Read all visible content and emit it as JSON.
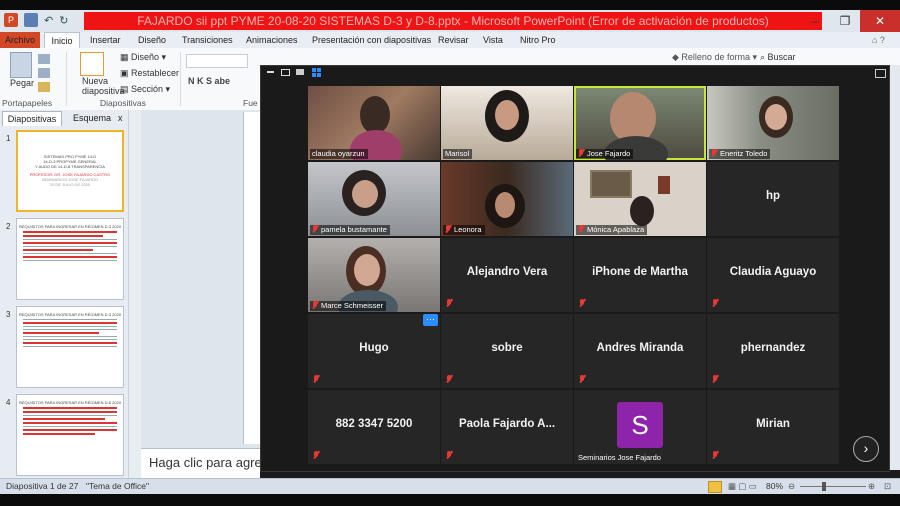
{
  "window": {
    "title": "FAJARDO sii ppt PYME 20-08-20 SISTEMAS D-3 y D-8.pptx  -  Microsoft PowerPoint (Error de activación de productos)",
    "controls": [
      "–",
      "❐",
      "✕"
    ]
  },
  "ribbon": {
    "tabs": [
      "Archivo",
      "Inicio",
      "Insertar",
      "Diseño",
      "Transiciones",
      "Animaciones",
      "Presentación con diapositivas",
      "Revisar",
      "Vista",
      "Nitro Pro"
    ],
    "paste_label": "Pegar",
    "new_slide_label": "Nueva diapositiva",
    "layout_label": "Diseño",
    "reset_label": "Restablecer",
    "section_label": "Sección",
    "group_clipboard": "Portapapeles",
    "group_slides": "Diapositivas",
    "group_font": "Fue",
    "font_buttons": "N K S abe",
    "shape_fill_label": "Relleno de forma",
    "find_label": "Buscar"
  },
  "panel": {
    "tab_slides": "Diapositivas",
    "tab_outline": "Esquema",
    "close": "x",
    "slides": [
      {
        "num": "1",
        "lines": [
          "SISTEMAS PRO PYME 14-D",
          "14-D-3  PROPYME GENERAL",
          "Y AUDO DE 14-D-8 TRANSPARENCIA",
          "PROFESOR: DR. JOSE FAJARDO CASTRO",
          "SEMINARIOS JOSE FAJARDO",
          "20 DE JULIO DE 2020"
        ]
      },
      {
        "num": "2",
        "heading": "REQUISITOS PARA INGRESAR EN RÉGIMEN D-3 2020"
      },
      {
        "num": "3",
        "heading": "REQUISITOS PARA INGRESAR EN RÉGIMEN D-3 2020"
      },
      {
        "num": "4",
        "heading": "REQUISITOS PARA INGRESAR EN RÉGIMEN D-8 2020"
      }
    ]
  },
  "notes_placeholder": "Haga clic para agregar",
  "status": {
    "slide_info": "Diapositiva 1 de 27",
    "theme": "\"Tema de Office\"",
    "zoom": "80%"
  },
  "meeting": {
    "participants": [
      {
        "name": "claudia oyarzun",
        "video": true,
        "muted": false,
        "bg": "#7a5a4a"
      },
      {
        "name": "Marisol",
        "video": true,
        "muted": false,
        "bg": "#9a8a7a"
      },
      {
        "name": "Jose Fajardo",
        "video": true,
        "muted": true,
        "bg": "#6a6a62",
        "active": true
      },
      {
        "name": "Eneritz Toledo",
        "video": true,
        "muted": true,
        "bg": "#8a8c80"
      },
      {
        "name": "pamela bustamante",
        "video": true,
        "muted": true,
        "bg": "#9a9ea2"
      },
      {
        "name": "Leonora",
        "video": true,
        "muted": true,
        "bg": "#5a4a3a"
      },
      {
        "name": "Mónica Apablaza",
        "video": true,
        "muted": true,
        "bg": "#b8b0a2"
      },
      {
        "name": "hp",
        "video": false,
        "muted": false
      },
      {
        "name": "Marce Schmeisser",
        "video": true,
        "muted": true,
        "bg": "#8e8a88"
      },
      {
        "name": "Alejandro Vera",
        "video": false,
        "muted": true
      },
      {
        "name": "iPhone de Martha",
        "video": false,
        "muted": true
      },
      {
        "name": "Claudia Aguayo",
        "video": false,
        "muted": true
      },
      {
        "name": "Hugo",
        "video": false,
        "muted": true
      },
      {
        "name": "sobre",
        "video": false,
        "muted": true
      },
      {
        "name": "Andres Miranda",
        "video": false,
        "muted": true
      },
      {
        "name": "phernandez",
        "video": false,
        "muted": true
      },
      {
        "name": "882 3347 5200",
        "video": false,
        "muted": true
      },
      {
        "name": "Paola Fajardo A...",
        "video": false,
        "muted": true
      },
      {
        "name": "Seminarios Jose Fajardo",
        "video": false,
        "muted": false,
        "avatar": "S"
      },
      {
        "name": "Mirian",
        "video": false,
        "muted": true
      }
    ],
    "more_button": "···",
    "next_button": "›",
    "colors": {
      "avatar": "#8e24aa",
      "active_border": "#c7e63a",
      "mute": "#e53935"
    }
  }
}
